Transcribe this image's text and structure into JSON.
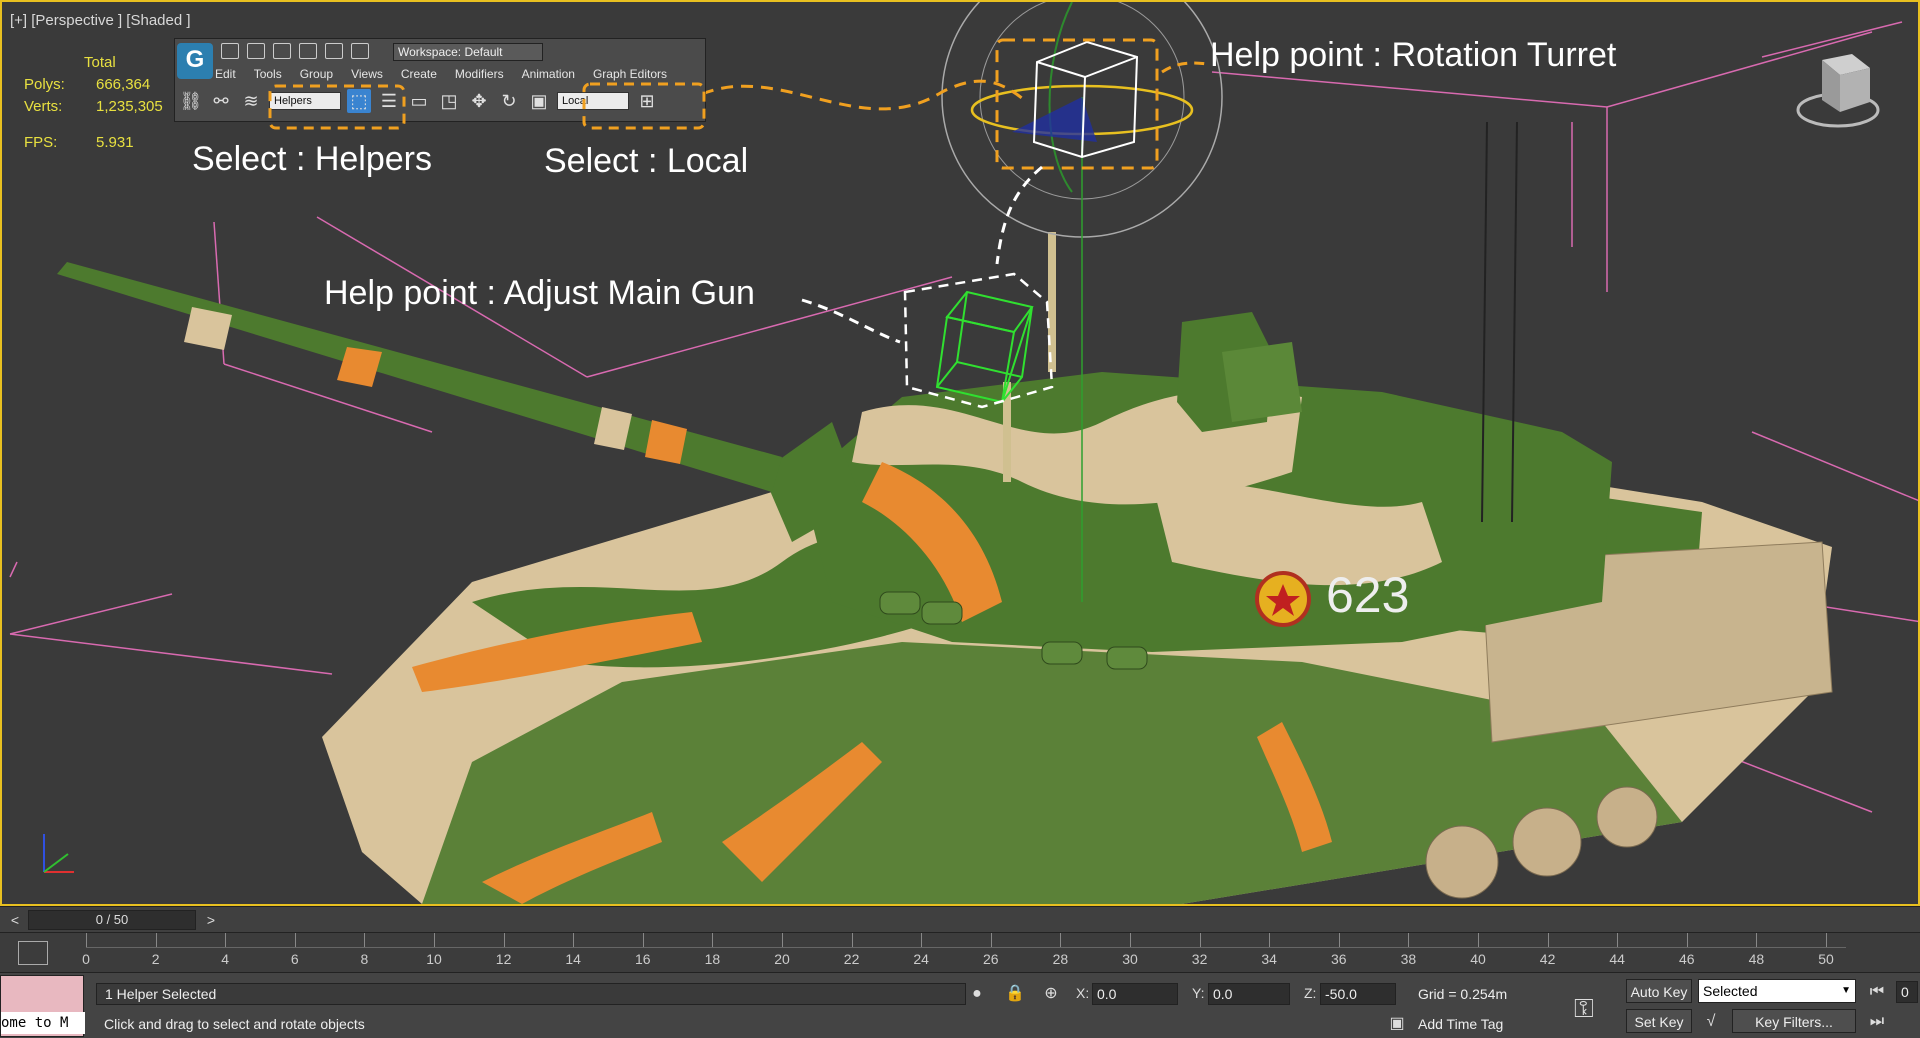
{
  "viewport": {
    "label": "[+] [Perspective ] [Shaded ]",
    "stats": {
      "header": "Total",
      "polys_label": "Polys:",
      "polys_value": "666,364",
      "verts_label": "Verts:",
      "verts_value": "1,235,305",
      "fps_label": "FPS:",
      "fps_value": "5.931"
    },
    "decal_number": "623"
  },
  "toolbar_panel": {
    "workspace": "Workspace: Default",
    "menu": [
      "Edit",
      "Tools",
      "Group",
      "Views",
      "Create",
      "Modifiers",
      "Animation",
      "Graph Editors"
    ],
    "selection_filter": "Helpers",
    "reference_coord": "Local"
  },
  "annotations": {
    "rotation_turret": "Help point : Rotation Turret",
    "select_helpers": "Select : Helpers",
    "select_local": "Select : Local",
    "adjust_main_gun": "Help point : Adjust Main Gun"
  },
  "timebar": {
    "prev": "<",
    "next": ">",
    "slider": "0 / 50"
  },
  "track": {
    "ticks": [
      "0",
      "2",
      "4",
      "6",
      "8",
      "10",
      "12",
      "14",
      "16",
      "18",
      "20",
      "22",
      "24",
      "26",
      "28",
      "30",
      "32",
      "34",
      "36",
      "38",
      "40",
      "42",
      "44",
      "46",
      "48",
      "50"
    ]
  },
  "status": {
    "maxscript": "ome to M",
    "selection": "1 Helper Selected",
    "prompt": "Click and drag to select and rotate objects",
    "x_label": "X:",
    "x_value": "0.0",
    "y_label": "Y:",
    "y_value": "0.0",
    "z_label": "Z:",
    "z_value": "-50.0",
    "grid": "Grid = 0.254m",
    "add_time_tag": "Add Time Tag",
    "auto_key": "Auto Key",
    "set_key": "Set Key",
    "key_mode": "Selected",
    "key_filters": "Key Filters...",
    "frame": "0"
  },
  "colors": {
    "accent_yellow": "#e8c020",
    "stat_yellow": "#e8e040",
    "annotation_orange": "#f0a020",
    "camo_green": "#4d7a2e",
    "camo_sand": "#d9c49c",
    "camo_orange": "#e88a30"
  }
}
